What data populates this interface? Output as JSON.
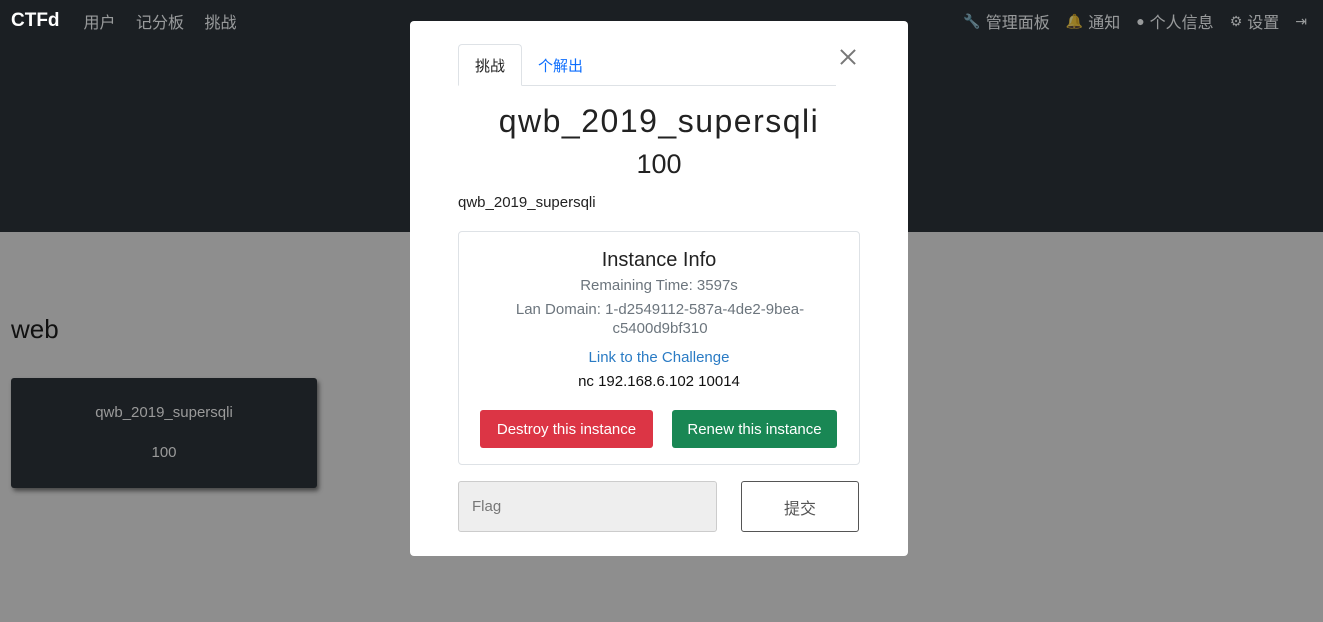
{
  "navbar": {
    "brand": "CTFd",
    "left_links": [
      "用户",
      "记分板",
      "挑战"
    ],
    "right_links": [
      {
        "icon": "wrench-icon",
        "label": "管理面板"
      },
      {
        "icon": "bell-icon",
        "label": "通知"
      },
      {
        "icon": "user-circle-icon",
        "label": "个人信息"
      },
      {
        "icon": "cogs-icon",
        "label": "设置"
      },
      {
        "icon": "sign-out-icon",
        "label": ""
      }
    ]
  },
  "page": {
    "category": "web",
    "card": {
      "name": "qwb_2019_supersqli",
      "value": "100"
    }
  },
  "modal": {
    "tabs": [
      {
        "label": "挑战",
        "active": true
      },
      {
        "label": "个解出",
        "active": false
      }
    ],
    "title": "qwb_2019_supersqli",
    "value": "100",
    "description": "qwb_2019_supersqli",
    "instance": {
      "heading": "Instance Info",
      "remaining": "Remaining Time: 3597s",
      "lan_domain": "Lan Domain: 1-d2549112-587a-4de2-9bea-c5400d9bf310",
      "link_text": "Link to the Challenge",
      "nc": "nc 192.168.6.102 10014",
      "destroy_label": "Destroy this instance",
      "renew_label": "Renew this instance"
    },
    "flag_placeholder": "Flag",
    "submit_label": "提交"
  },
  "colors": {
    "danger": "#dc3545",
    "success": "#198754",
    "link": "#2a7bc4",
    "tab_link": "#0d6efd",
    "navbar_bg": "#1b1f23"
  }
}
